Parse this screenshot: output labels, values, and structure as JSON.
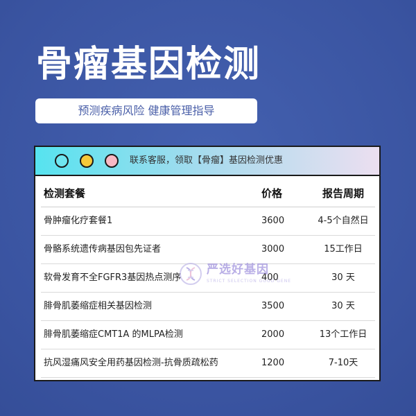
{
  "title": "骨瘤基因检测",
  "subtitle": "预测疾病风险 健康管理指导",
  "card": {
    "header_text": "联系客服，领取【骨瘤】基因检测优惠",
    "columns": {
      "name": "检测套餐",
      "price": "价格",
      "period": "报告周期"
    },
    "rows": [
      {
        "name": "骨肿瘤化疗套餐1",
        "price": "3600",
        "period": "4-5个自然日"
      },
      {
        "name": "骨骼系统遗传病基因包先证者",
        "price": "3000",
        "period": "15工作日"
      },
      {
        "name": "软骨发育不全FGFR3基因热点测序",
        "price": "400",
        "period": "30 天"
      },
      {
        "name": "腓骨肌萎缩症相关基因检测",
        "price": "3500",
        "period": "30 天"
      },
      {
        "name": "腓骨肌萎缩症CMT1A 的MLPA检测",
        "price": "2000",
        "period": "13个工作日"
      },
      {
        "name": "抗风湿痛风安全用药基因检测-抗骨质疏松药",
        "price": "1200",
        "period": "7-10天"
      }
    ]
  },
  "watermark": {
    "text": "严选好基因",
    "sub": "STRICT SELECTION GOOD GENE"
  },
  "colors": {
    "background": "#3f5aa7",
    "accent_text": "#4a5fa8",
    "dot_cyan": "#6fe6f0",
    "dot_yellow": "#f5c93a",
    "dot_pink": "#f8b8c4"
  }
}
